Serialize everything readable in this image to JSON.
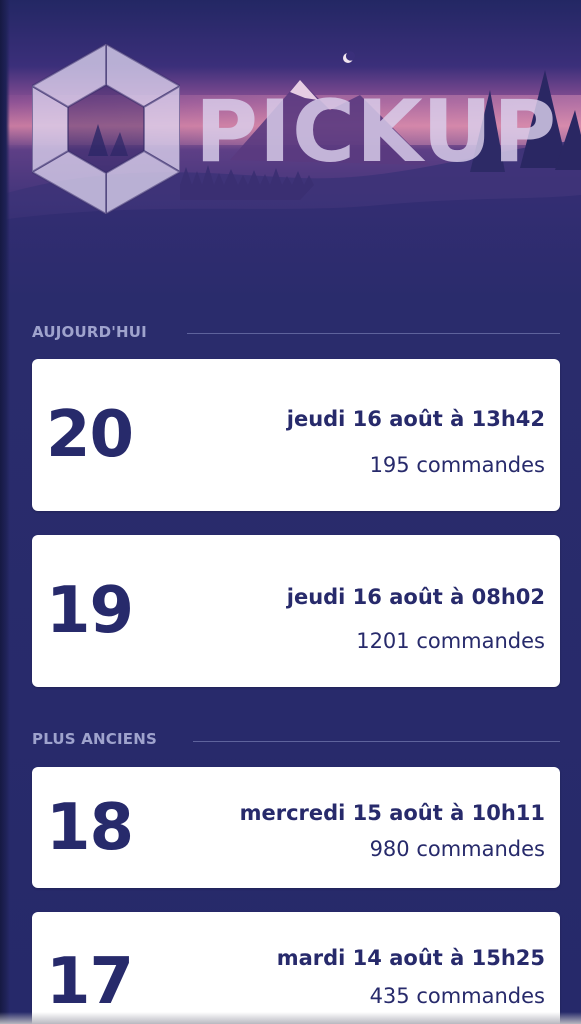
{
  "header": {
    "brand": "PICKUP",
    "logo_icon": "hexagon-logo-icon",
    "moon_icon": "crescent-moon-icon"
  },
  "sections": {
    "today_label": "AUJOURD'HUI",
    "older_label": "PLUS ANCIENS"
  },
  "cards": [
    {
      "number": "20",
      "date": "jeudi 16 août à 13h42",
      "count": "195 commandes"
    },
    {
      "number": "19",
      "date": "jeudi 16 août à 08h02",
      "count": "1201 commandes"
    },
    {
      "number": "18",
      "date": "mercredi 15 août à 10h11",
      "count": "980 commandes"
    },
    {
      "number": "17",
      "date": "mardi 14 août à 15h25",
      "count": "435 commandes"
    }
  ],
  "colors": {
    "background": "#2a2c6c",
    "card_text": "#272a6b",
    "section_label": "#9fa3cd",
    "card_background": "#ffffff"
  }
}
